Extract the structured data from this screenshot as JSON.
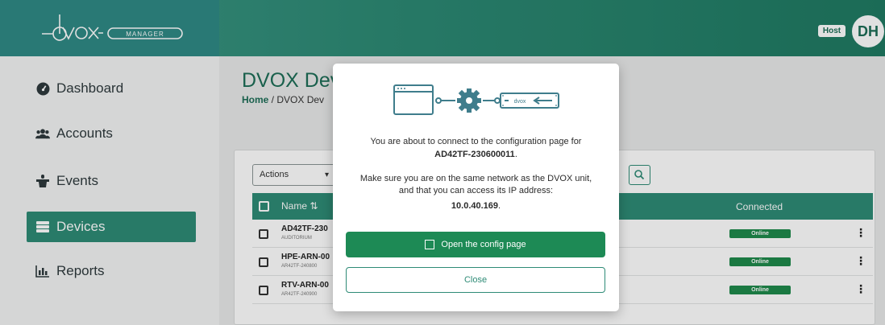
{
  "header": {
    "logo_text": "dvox",
    "logo_badge": "MANAGER",
    "role_badge": "Host",
    "avatar_initials": "DH"
  },
  "sidebar": {
    "items": [
      {
        "label": "Dashboard",
        "icon": "dashboard-gauge-icon"
      },
      {
        "label": "Accounts",
        "icon": "users-icon"
      },
      {
        "label": "Events",
        "icon": "podium-icon"
      },
      {
        "label": "Devices",
        "icon": "server-icon",
        "active": true
      },
      {
        "label": "Reports",
        "icon": "bar-chart-icon"
      }
    ]
  },
  "main": {
    "page_title": "DVOX Dev",
    "breadcrumb": {
      "home": "Home",
      "separator": " / ",
      "current": "DVOX Dev"
    },
    "actions_label": "Actions",
    "table": {
      "columns": [
        "Name",
        "Connected"
      ],
      "rows": [
        {
          "name": "AD42TF-230",
          "sub": "AUDITORIUM",
          "status": "Online"
        },
        {
          "name": "HPE-ARN-00",
          "sub": "AR42TF-240800",
          "status": "Online"
        },
        {
          "name": "RTV-ARN-00",
          "sub": "AR42TF-240900",
          "status": "Online"
        }
      ]
    }
  },
  "modal": {
    "illustration_label": "dvox",
    "line1": "You are about to connect to the configuration page for",
    "device_id": "AD42TF-230600011",
    "line2_suffix": ".",
    "line3": "Make sure you are on the same network as the DVOX unit, and that you can access its IP address:",
    "ip": "10.0.40.169",
    "ip_suffix": ".",
    "open_button": "Open the config page",
    "close_button": "Close"
  },
  "colors": {
    "brand": "#2e8b76",
    "brand_dark": "#1d6e57",
    "success": "#1d8a55",
    "status_online": "#1f8a4c"
  }
}
